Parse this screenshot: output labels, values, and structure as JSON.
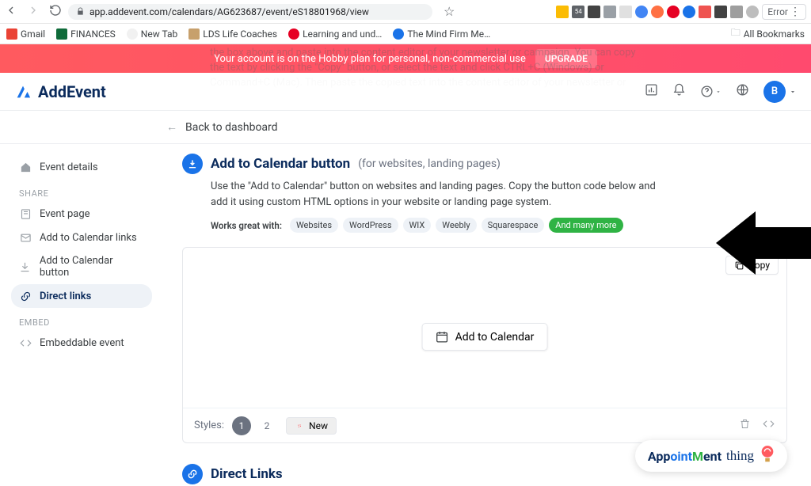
{
  "browser": {
    "url": "app.addevent.com/calendars/AG623687/event/eS18801968/view",
    "error_label": "Error"
  },
  "bookmarks": [
    {
      "label": "Gmail",
      "color": "#ea4335"
    },
    {
      "label": "FINANCES",
      "color": "#0f6b3a"
    },
    {
      "label": "New Tab",
      "color": "#5f6368"
    },
    {
      "label": "LDS Life Coaches",
      "color": "#c7a06c"
    },
    {
      "label": "Learning and und…",
      "color": "#e60023"
    },
    {
      "label": "The Mind Firm Me…",
      "color": "#1a73e8"
    }
  ],
  "all_bookmarks_label": "All Bookmarks",
  "banner": {
    "text": "Your account is on the Hobby plan for personal, non-commercial use",
    "button": "UPGRADE"
  },
  "header": {
    "brand": "AddEvent",
    "ghost_text": "the box above and paste into the content editor of your newsletter or campaign. You can copy the text by clicking the \"Copy\" button, or select the text and click CTRL+C (Windows) or Command+C (Mac). Then paste the copied text into the content editor of your newsletter or",
    "avatar_initial": "B"
  },
  "back_label": "Back to dashboard",
  "sidebar": {
    "items": [
      {
        "icon": "home",
        "label": "Event details"
      },
      {
        "section": "SHARE"
      },
      {
        "icon": "page",
        "label": "Event page"
      },
      {
        "icon": "mail",
        "label": "Add to Calendar links"
      },
      {
        "icon": "download",
        "label": "Add to Calendar button"
      },
      {
        "icon": "link",
        "label": "Direct links",
        "active": true
      },
      {
        "section": "EMBED"
      },
      {
        "icon": "code",
        "label": "Embeddable event"
      }
    ]
  },
  "section": {
    "title": "Add to Calendar button",
    "subtitle": "(for websites, landing pages)",
    "description": "Use the \"Add to Calendar\" button on websites and landing pages. Copy the button code below and add it using custom HTML options in your website or landing page system.",
    "works_label": "Works great with:",
    "tags": [
      "Websites",
      "WordPress",
      "WIX",
      "Weebly",
      "Squarespace"
    ],
    "more_tag": "And many more"
  },
  "preview": {
    "copy_label": "Copy",
    "atc_label": "Add to Calendar",
    "styles_label": "Styles:",
    "style1": "1",
    "style2": "2",
    "new_label": "New"
  },
  "direct_links": {
    "title": "Direct Links"
  },
  "widget": {
    "part1": "App",
    "part2": "oint",
    "part3": "M",
    "part4": "ent",
    "cursive": "thing"
  }
}
